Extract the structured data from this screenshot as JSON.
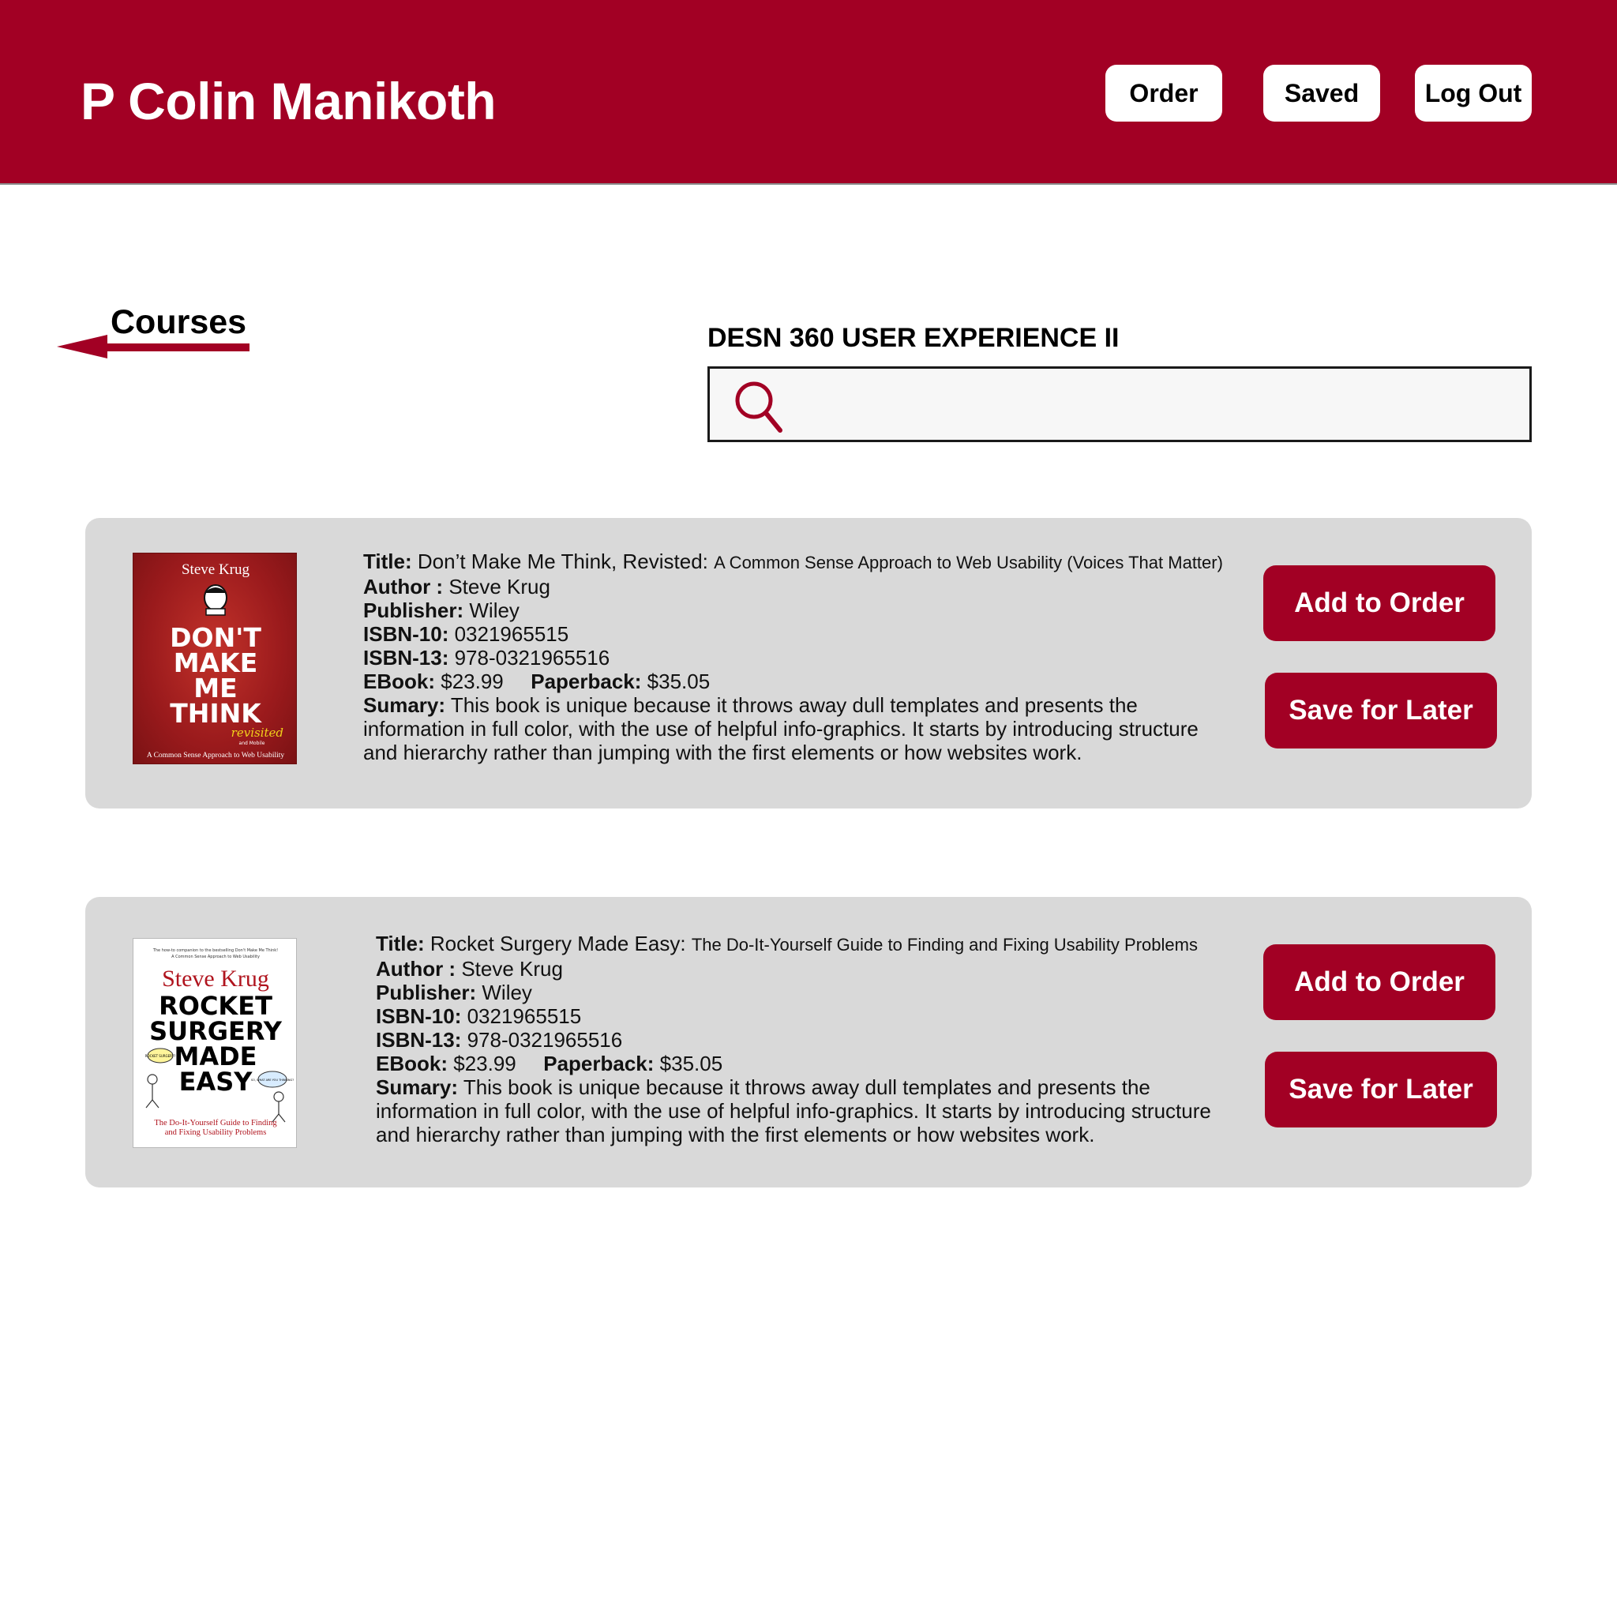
{
  "header": {
    "title": "P Colin Manikoth",
    "nav": {
      "order": "Order",
      "saved": "Saved",
      "logout": "Log Out"
    }
  },
  "back_link": {
    "label": "Courses"
  },
  "course": {
    "title": "DESN 360 USER EXPERIENCE II"
  },
  "search": {
    "placeholder": ""
  },
  "colors": {
    "brand": "#a20024",
    "card": "#d9d9d9",
    "search_bg": "#f7f7f7"
  },
  "books": [
    {
      "cover": {
        "author": "Steve Krug",
        "lines": [
          "DON'T",
          "MAKE",
          "ME",
          "THINK"
        ],
        "badge": "revisited",
        "bottom": "A Common Sense Approach to Web Usability",
        "inset": "and Mobile"
      },
      "title_label": "Title:",
      "title_main": "Don’t Make Me Think, Revisted:",
      "title_sub": "A Common Sense Approach to Web Usability (Voices That Matter)",
      "author_label": "Author :",
      "author": "Steve Krug",
      "publisher_label": "Publisher:",
      "publisher": "Wiley",
      "isbn10_label": "ISBN-10:",
      "isbn10": "0321965515",
      "isbn13_label": "ISBN-13:",
      "isbn13": "978-0321965516",
      "ebook_label": "EBook:",
      "ebook": "$23.99",
      "paperback_label": "Paperback:",
      "paperback": "$35.05",
      "summary_label": "Sumary:",
      "summary": "This book is unique because it throws away dull templates and presents the information in full color, with the use of helpful info-graphics. It starts by introducing structure and hierarchy rather than jumping with the first elements or how websites work.",
      "add_label": "Add to Order",
      "save_label": "Save for Later"
    },
    {
      "cover": {
        "tagline1": "The how-to companion to the bestselling Don't Make Me Think!",
        "tagline2": "A Common Sense Approach to Web Usability",
        "author": "Steve Krug",
        "lines": [
          "ROCKET",
          "SURGERY",
          "MADE",
          "EASY"
        ],
        "bubble1": "ROCKET SURGERY?",
        "bubble2": "SO, WHAT ARE YOU THINKING?",
        "bottom1": "The Do-It-Yourself Guide to Finding",
        "bottom2": "and Fixing Usability Problems"
      },
      "title_label": "Title:",
      "title_main": "Rocket Surgery Made Easy:",
      "title_sub": "The Do-It-Yourself Guide to Finding and Fixing Usability Problems",
      "author_label": "Author :",
      "author": "Steve Krug",
      "publisher_label": "Publisher:",
      "publisher": "Wiley",
      "isbn10_label": "ISBN-10:",
      "isbn10": "0321965515",
      "isbn13_label": "ISBN-13:",
      "isbn13": "978-0321965516",
      "ebook_label": "EBook:",
      "ebook": "$23.99",
      "paperback_label": "Paperback:",
      "paperback": "$35.05",
      "summary_label": "Sumary:",
      "summary": "This book is unique because it throws away dull templates and presents the information in full color, with the use of helpful info-graphics. It starts by introducing structure and hierarchy rather than jumping with the first elements or how websites work.",
      "add_label": "Add to Order",
      "save_label": "Save for Later"
    }
  ]
}
